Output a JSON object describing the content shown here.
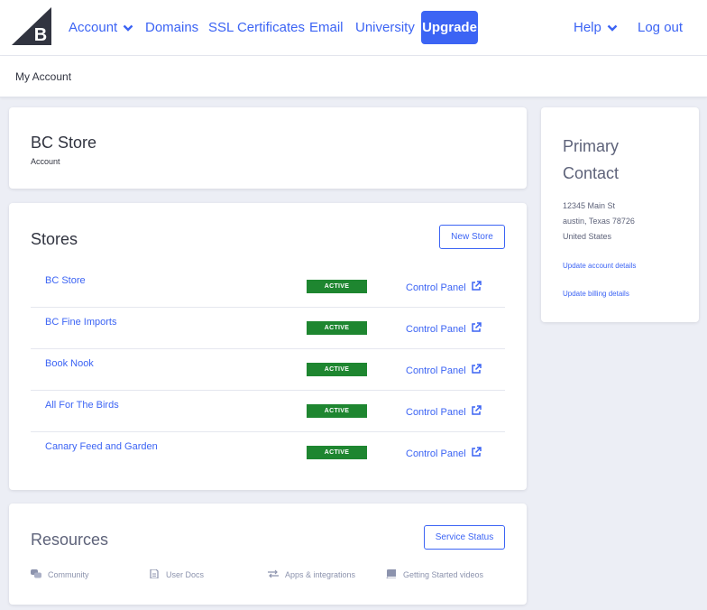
{
  "nav": {
    "logo_letter": "B",
    "account": "Account",
    "domains": "Domains",
    "ssl": "SSL Certificates",
    "email": "Email",
    "university": "University",
    "upgrade": "Upgrade",
    "help": "Help",
    "logout": "Log out"
  },
  "breadcrumb": "My Account",
  "account_card": {
    "title": "BC Store",
    "subtitle": "Account"
  },
  "stores": {
    "title": "Stores",
    "new_store_label": "New Store",
    "items": [
      {
        "name": "BC Store",
        "status": "ACTIVE",
        "link": "Control Panel"
      },
      {
        "name": "BC Fine Imports",
        "status": "ACTIVE",
        "link": "Control Panel"
      },
      {
        "name": "Book Nook",
        "status": "ACTIVE",
        "link": "Control Panel"
      },
      {
        "name": "All For The Birds",
        "status": "ACTIVE",
        "link": "Control Panel"
      },
      {
        "name": "Canary Feed and Garden",
        "status": "ACTIVE",
        "link": "Control Panel"
      }
    ]
  },
  "resources": {
    "title": "Resources",
    "service_status_label": "Service Status",
    "items": [
      {
        "label": "Community",
        "icon": "chat-bubbles-icon"
      },
      {
        "label": "User Docs",
        "icon": "document-icon"
      },
      {
        "label": "Apps & integrations",
        "icon": "swap-arrows-icon"
      },
      {
        "label": "Getting Started videos",
        "icon": "book-icon"
      }
    ]
  },
  "contact": {
    "title": "Primary Contact",
    "address_line1": "12345 Main St",
    "address_line2": "austin, Texas 78726",
    "address_line3": "United States",
    "update_account": "Update account details",
    "update_billing": "Update billing details"
  },
  "colors": {
    "accent": "#3c64f4",
    "active_badge": "#1e8630",
    "background": "#eceef5",
    "logo": "#313440"
  }
}
